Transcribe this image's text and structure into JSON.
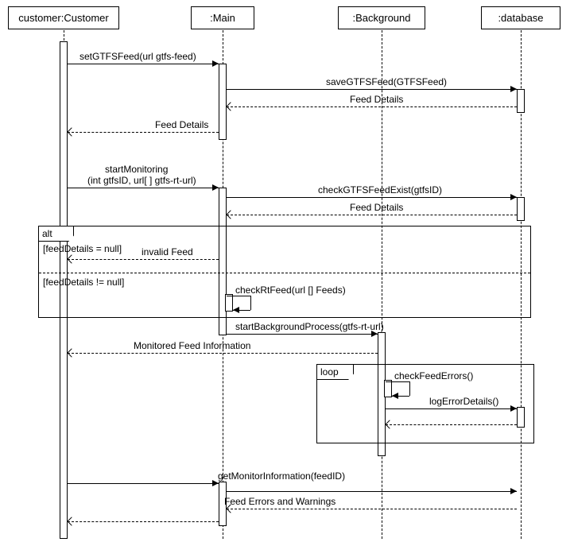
{
  "actors": {
    "customer": "customer:Customer",
    "main": ":Main",
    "background": ":Background",
    "database": ":database"
  },
  "messages": {
    "setGTFSFeed": "setGTFSFeed(url gtfs-feed)",
    "saveGTFSFeed": "saveGTFSFeed(GTFSFeed)",
    "feedDetails1": "Feed Details",
    "feedDetails2": "Feed Details",
    "startMonitoring1": "startMonitoring",
    "startMonitoring2": "(int gtfsID, url[ ] gtfs-rt-url)",
    "checkGTFSFeedExist": "checkGTFSFeedExist(gtfsID)",
    "feedDetails3": "Feed Details",
    "invalidFeed": "invalid Feed",
    "checkRtFeed": "checkRtFeed(url [] Feeds)",
    "startBackgroundProcess": "startBackgroundProcess(gtfs-rt-url)",
    "monitoredFeedInfo": "Monitored Feed Information",
    "checkFeedErrors": "checkFeedErrors()",
    "logErrorDetails": "logErrorDetails()",
    "getMonitorInfo": "getMonitorInformation(feedID)",
    "feedErrorsWarnings": "Feed Errors and Warnings"
  },
  "fragments": {
    "alt": "alt",
    "loop": "loop"
  },
  "guards": {
    "null": "[feedDetails = null]",
    "notNull": "[feedDetails != null]"
  }
}
